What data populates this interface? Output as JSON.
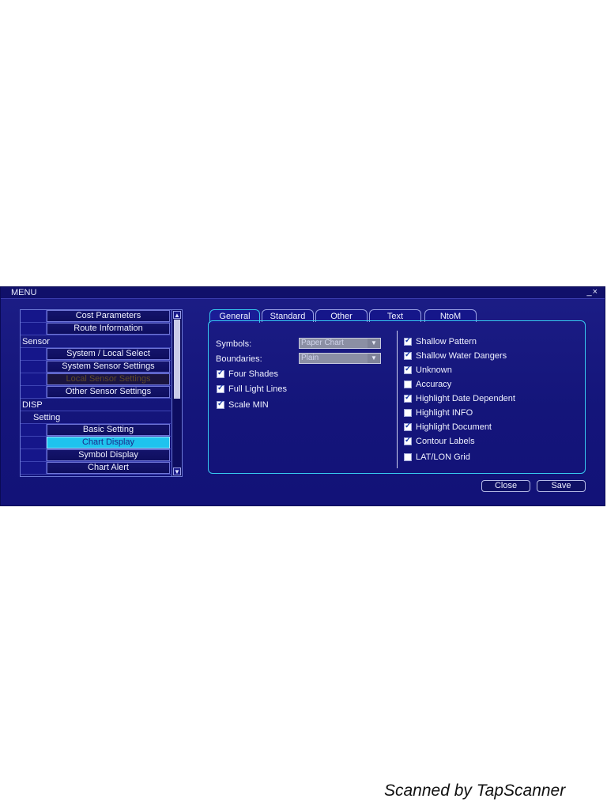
{
  "window": {
    "title": "MENU",
    "controls": "_×"
  },
  "sidebar": {
    "rows": [
      {
        "kind": "item",
        "label": "Cost Parameters"
      },
      {
        "kind": "item",
        "label": "Route Information"
      },
      {
        "kind": "category",
        "label": "Sensor"
      },
      {
        "kind": "item",
        "label": "System / Local Select"
      },
      {
        "kind": "item",
        "label": "System Sensor Settings"
      },
      {
        "kind": "item",
        "label": "Local Sensor Settings",
        "state": "disabled"
      },
      {
        "kind": "item",
        "label": "Other Sensor Settings"
      },
      {
        "kind": "category",
        "label": "DISP"
      },
      {
        "kind": "subcategory",
        "label": "Setting"
      },
      {
        "kind": "item",
        "label": "Basic Setting"
      },
      {
        "kind": "item",
        "label": "Chart Display",
        "state": "selected"
      },
      {
        "kind": "item",
        "label": "Symbol Display"
      },
      {
        "kind": "item",
        "label": "Chart Alert"
      }
    ]
  },
  "tabs": [
    {
      "label": "General",
      "active": true
    },
    {
      "label": "Standard"
    },
    {
      "label": "Other"
    },
    {
      "label": "Text"
    },
    {
      "label": "NtoM"
    }
  ],
  "general": {
    "symbols_label": "Symbols:",
    "symbols_value": "Paper Chart",
    "boundaries_label": "Boundaries:",
    "boundaries_value": "Plain",
    "left_options": [
      {
        "label": "Four Shades",
        "checked": true
      },
      {
        "label": "Full Light Lines",
        "checked": true
      },
      {
        "label": "Scale MIN",
        "checked": true
      }
    ],
    "right_options": [
      {
        "label": "Shallow Pattern",
        "checked": true
      },
      {
        "label": "Shallow Water Dangers",
        "checked": true
      },
      {
        "label": "Unknown",
        "checked": true
      },
      {
        "label": "Accuracy",
        "checked": false
      },
      {
        "label": "Highlight Date Dependent",
        "checked": true
      },
      {
        "label": "Highlight INFO",
        "checked": false
      },
      {
        "label": "Highlight Document",
        "checked": true
      },
      {
        "label": "Contour Labels",
        "checked": true
      },
      {
        "label": "LAT/LON Grid",
        "checked": false
      }
    ]
  },
  "footer": {
    "close_label": "Close",
    "save_label": "Save"
  },
  "watermark": "Scanned by TapScanner",
  "colors": {
    "dialog_bg": "#1c1d86",
    "accent": "#36c8ef",
    "selected": "#1ec3ee"
  }
}
